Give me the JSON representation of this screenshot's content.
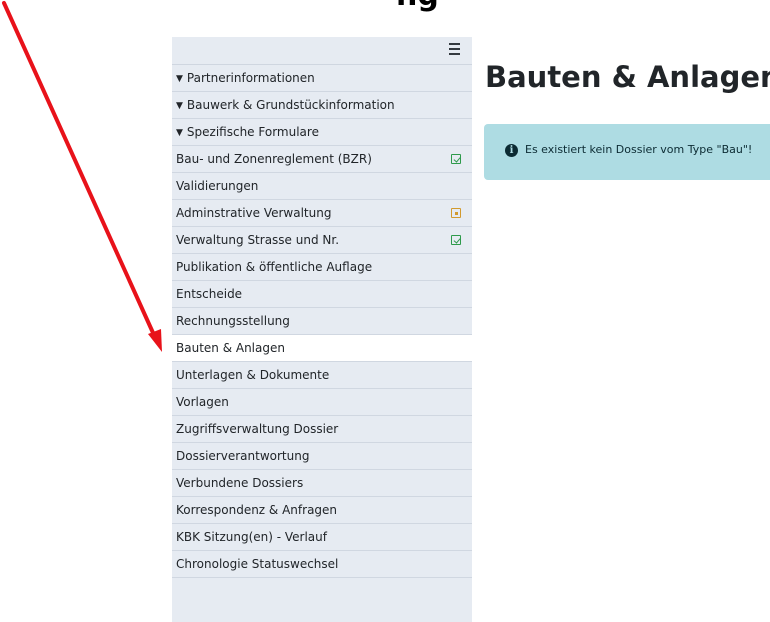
{
  "top_cutoff_text": "ng",
  "sidebar": {
    "menu_icon": "hamburger-icon",
    "items": [
      {
        "label": "Partnerinformationen",
        "expandable": true
      },
      {
        "label": "Bauwerk & Grundstückinformation",
        "expandable": true
      },
      {
        "label": "Spezifische Formulare",
        "expandable": true
      },
      {
        "label": "Bau- und Zonenreglement (BZR)",
        "status": "checked"
      },
      {
        "label": "Validierungen"
      },
      {
        "label": "Adminstrative Verwaltung",
        "status": "partial"
      },
      {
        "label": "Verwaltung Strasse und Nr.",
        "status": "checked"
      },
      {
        "label": "Publikation & öffentliche Auflage"
      },
      {
        "label": "Entscheide"
      },
      {
        "label": "Rechnungsstellung"
      },
      {
        "label": "Bauten & Anlagen",
        "active": true
      },
      {
        "label": "Unterlagen & Dokumente"
      },
      {
        "label": "Vorlagen"
      },
      {
        "label": "Zugriffsverwaltung Dossier"
      },
      {
        "label": "Dossierverantwortung"
      },
      {
        "label": "Verbundene Dossiers"
      },
      {
        "label": "Korrespondenz & Anfragen"
      },
      {
        "label": "KBK Sitzung(en) - Verlauf"
      },
      {
        "label": "Chronologie Statuswechsel"
      }
    ]
  },
  "main": {
    "title": "Bauten & Anlagen",
    "alert": {
      "icon": "info-icon",
      "icon_glyph": "i",
      "text": "Es existiert kein Dossier vom Type \"Bau\"!"
    }
  },
  "colors": {
    "annotation_arrow": "#e8121a",
    "sidebar_bg": "#e6ebf2",
    "alert_bg": "#aedce3",
    "status_checked": "#2e9a4b",
    "status_partial": "#d29a2e"
  }
}
